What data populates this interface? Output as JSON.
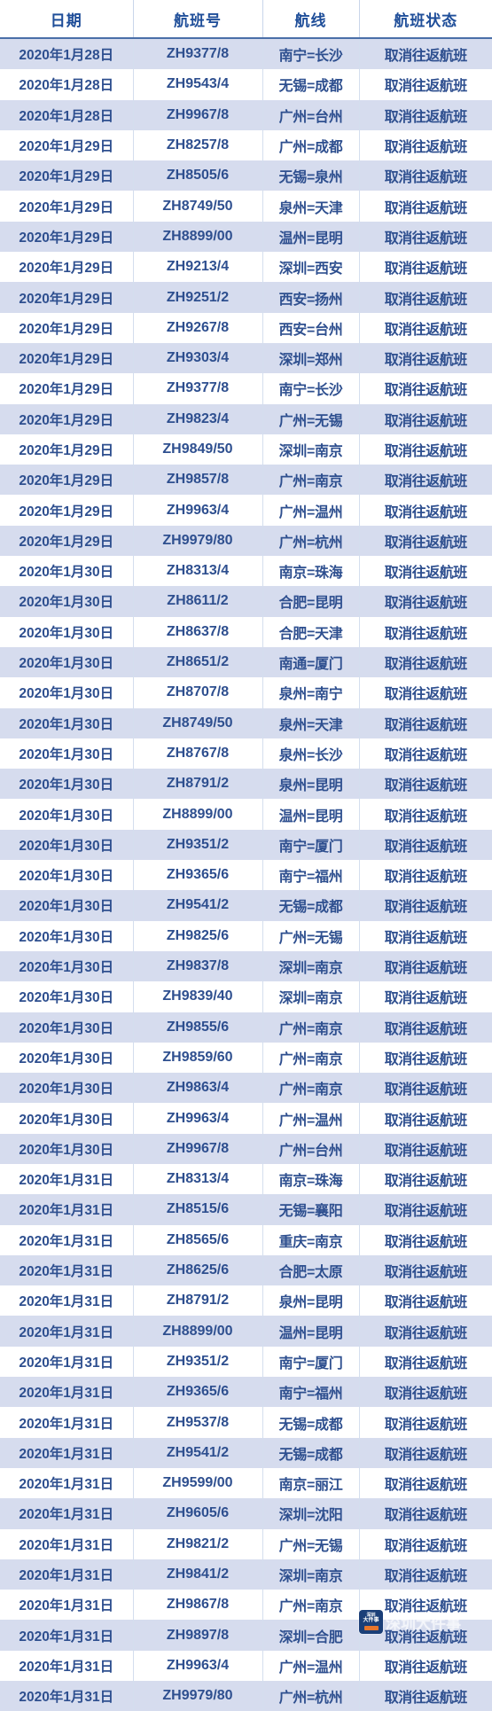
{
  "table": {
    "columns": [
      {
        "key": "date",
        "label": "日期"
      },
      {
        "key": "flight",
        "label": "航班号"
      },
      {
        "key": "route",
        "label": "航线"
      },
      {
        "key": "status",
        "label": "航班状态"
      }
    ],
    "rows": [
      {
        "date": "2020年1月28日",
        "flight": "ZH9377/8",
        "route": "南宁=长沙",
        "status": "取消往返航班"
      },
      {
        "date": "2020年1月28日",
        "flight": "ZH9543/4",
        "route": "无锡=成都",
        "status": "取消往返航班"
      },
      {
        "date": "2020年1月28日",
        "flight": "ZH9967/8",
        "route": "广州=台州",
        "status": "取消往返航班"
      },
      {
        "date": "2020年1月29日",
        "flight": "ZH8257/8",
        "route": "广州=成都",
        "status": "取消往返航班"
      },
      {
        "date": "2020年1月29日",
        "flight": "ZH8505/6",
        "route": "无锡=泉州",
        "status": "取消往返航班"
      },
      {
        "date": "2020年1月29日",
        "flight": "ZH8749/50",
        "route": "泉州=天津",
        "status": "取消往返航班"
      },
      {
        "date": "2020年1月29日",
        "flight": "ZH8899/00",
        "route": "温州=昆明",
        "status": "取消往返航班"
      },
      {
        "date": "2020年1月29日",
        "flight": "ZH9213/4",
        "route": "深圳=西安",
        "status": "取消往返航班"
      },
      {
        "date": "2020年1月29日",
        "flight": "ZH9251/2",
        "route": "西安=扬州",
        "status": "取消往返航班"
      },
      {
        "date": "2020年1月29日",
        "flight": "ZH9267/8",
        "route": "西安=台州",
        "status": "取消往返航班"
      },
      {
        "date": "2020年1月29日",
        "flight": "ZH9303/4",
        "route": "深圳=郑州",
        "status": "取消往返航班"
      },
      {
        "date": "2020年1月29日",
        "flight": "ZH9377/8",
        "route": "南宁=长沙",
        "status": "取消往返航班"
      },
      {
        "date": "2020年1月29日",
        "flight": "ZH9823/4",
        "route": "广州=无锡",
        "status": "取消往返航班"
      },
      {
        "date": "2020年1月29日",
        "flight": "ZH9849/50",
        "route": "深圳=南京",
        "status": "取消往返航班"
      },
      {
        "date": "2020年1月29日",
        "flight": "ZH9857/8",
        "route": "广州=南京",
        "status": "取消往返航班"
      },
      {
        "date": "2020年1月29日",
        "flight": "ZH9963/4",
        "route": "广州=温州",
        "status": "取消往返航班"
      },
      {
        "date": "2020年1月29日",
        "flight": "ZH9979/80",
        "route": "广州=杭州",
        "status": "取消往返航班"
      },
      {
        "date": "2020年1月30日",
        "flight": "ZH8313/4",
        "route": "南京=珠海",
        "status": "取消往返航班"
      },
      {
        "date": "2020年1月30日",
        "flight": "ZH8611/2",
        "route": "合肥=昆明",
        "status": "取消往返航班"
      },
      {
        "date": "2020年1月30日",
        "flight": "ZH8637/8",
        "route": "合肥=天津",
        "status": "取消往返航班"
      },
      {
        "date": "2020年1月30日",
        "flight": "ZH8651/2",
        "route": "南通=厦门",
        "status": "取消往返航班"
      },
      {
        "date": "2020年1月30日",
        "flight": "ZH8707/8",
        "route": "泉州=南宁",
        "status": "取消往返航班"
      },
      {
        "date": "2020年1月30日",
        "flight": "ZH8749/50",
        "route": "泉州=天津",
        "status": "取消往返航班"
      },
      {
        "date": "2020年1月30日",
        "flight": "ZH8767/8",
        "route": "泉州=长沙",
        "status": "取消往返航班"
      },
      {
        "date": "2020年1月30日",
        "flight": "ZH8791/2",
        "route": "泉州=昆明",
        "status": "取消往返航班"
      },
      {
        "date": "2020年1月30日",
        "flight": "ZH8899/00",
        "route": "温州=昆明",
        "status": "取消往返航班"
      },
      {
        "date": "2020年1月30日",
        "flight": "ZH9351/2",
        "route": "南宁=厦门",
        "status": "取消往返航班"
      },
      {
        "date": "2020年1月30日",
        "flight": "ZH9365/6",
        "route": "南宁=福州",
        "status": "取消往返航班"
      },
      {
        "date": "2020年1月30日",
        "flight": "ZH9541/2",
        "route": "无锡=成都",
        "status": "取消往返航班"
      },
      {
        "date": "2020年1月30日",
        "flight": "ZH9825/6",
        "route": "广州=无锡",
        "status": "取消往返航班"
      },
      {
        "date": "2020年1月30日",
        "flight": "ZH9837/8",
        "route": "深圳=南京",
        "status": "取消往返航班"
      },
      {
        "date": "2020年1月30日",
        "flight": "ZH9839/40",
        "route": "深圳=南京",
        "status": "取消往返航班"
      },
      {
        "date": "2020年1月30日",
        "flight": "ZH9855/6",
        "route": "广州=南京",
        "status": "取消往返航班"
      },
      {
        "date": "2020年1月30日",
        "flight": "ZH9859/60",
        "route": "广州=南京",
        "status": "取消往返航班"
      },
      {
        "date": "2020年1月30日",
        "flight": "ZH9863/4",
        "route": "广州=南京",
        "status": "取消往返航班"
      },
      {
        "date": "2020年1月30日",
        "flight": "ZH9963/4",
        "route": "广州=温州",
        "status": "取消往返航班"
      },
      {
        "date": "2020年1月30日",
        "flight": "ZH9967/8",
        "route": "广州=台州",
        "status": "取消往返航班"
      },
      {
        "date": "2020年1月31日",
        "flight": "ZH8313/4",
        "route": "南京=珠海",
        "status": "取消往返航班"
      },
      {
        "date": "2020年1月31日",
        "flight": "ZH8515/6",
        "route": "无锡=襄阳",
        "status": "取消往返航班"
      },
      {
        "date": "2020年1月31日",
        "flight": "ZH8565/6",
        "route": "重庆=南京",
        "status": "取消往返航班"
      },
      {
        "date": "2020年1月31日",
        "flight": "ZH8625/6",
        "route": "合肥=太原",
        "status": "取消往返航班"
      },
      {
        "date": "2020年1月31日",
        "flight": "ZH8791/2",
        "route": "泉州=昆明",
        "status": "取消往返航班"
      },
      {
        "date": "2020年1月31日",
        "flight": "ZH8899/00",
        "route": "温州=昆明",
        "status": "取消往返航班"
      },
      {
        "date": "2020年1月31日",
        "flight": "ZH9351/2",
        "route": "南宁=厦门",
        "status": "取消往返航班"
      },
      {
        "date": "2020年1月31日",
        "flight": "ZH9365/6",
        "route": "南宁=福州",
        "status": "取消往返航班"
      },
      {
        "date": "2020年1月31日",
        "flight": "ZH9537/8",
        "route": "无锡=成都",
        "status": "取消往返航班"
      },
      {
        "date": "2020年1月31日",
        "flight": "ZH9541/2",
        "route": "无锡=成都",
        "status": "取消往返航班"
      },
      {
        "date": "2020年1月31日",
        "flight": "ZH9599/00",
        "route": "南京=丽江",
        "status": "取消往返航班"
      },
      {
        "date": "2020年1月31日",
        "flight": "ZH9605/6",
        "route": "深圳=沈阳",
        "status": "取消往返航班"
      },
      {
        "date": "2020年1月31日",
        "flight": "ZH9821/2",
        "route": "广州=无锡",
        "status": "取消往返航班"
      },
      {
        "date": "2020年1月31日",
        "flight": "ZH9841/2",
        "route": "深圳=南京",
        "status": "取消往返航班"
      },
      {
        "date": "2020年1月31日",
        "flight": "ZH9867/8",
        "route": "广州=南京",
        "status": "取消往返航班"
      },
      {
        "date": "2020年1月31日",
        "flight": "ZH9897/8",
        "route": "深圳=合肥",
        "status": "取消往返航班"
      },
      {
        "date": "2020年1月31日",
        "flight": "ZH9963/4",
        "route": "广州=温州",
        "status": "取消往返航班"
      },
      {
        "date": "2020年1月31日",
        "flight": "ZH9979/80",
        "route": "广州=杭州",
        "status": "取消往返航班"
      }
    ]
  },
  "watermark": {
    "logo_line1": "深圳",
    "logo_line2": "大件事",
    "text": "深圳大件事"
  },
  "colors": {
    "header_text": "#1f4e99",
    "cell_text": "#2e4f8f",
    "row_even_bg": "#d6dcee",
    "row_odd_bg": "#ffffff",
    "header_rule": "#4a6fa8",
    "cell_border": "#d4deee"
  }
}
